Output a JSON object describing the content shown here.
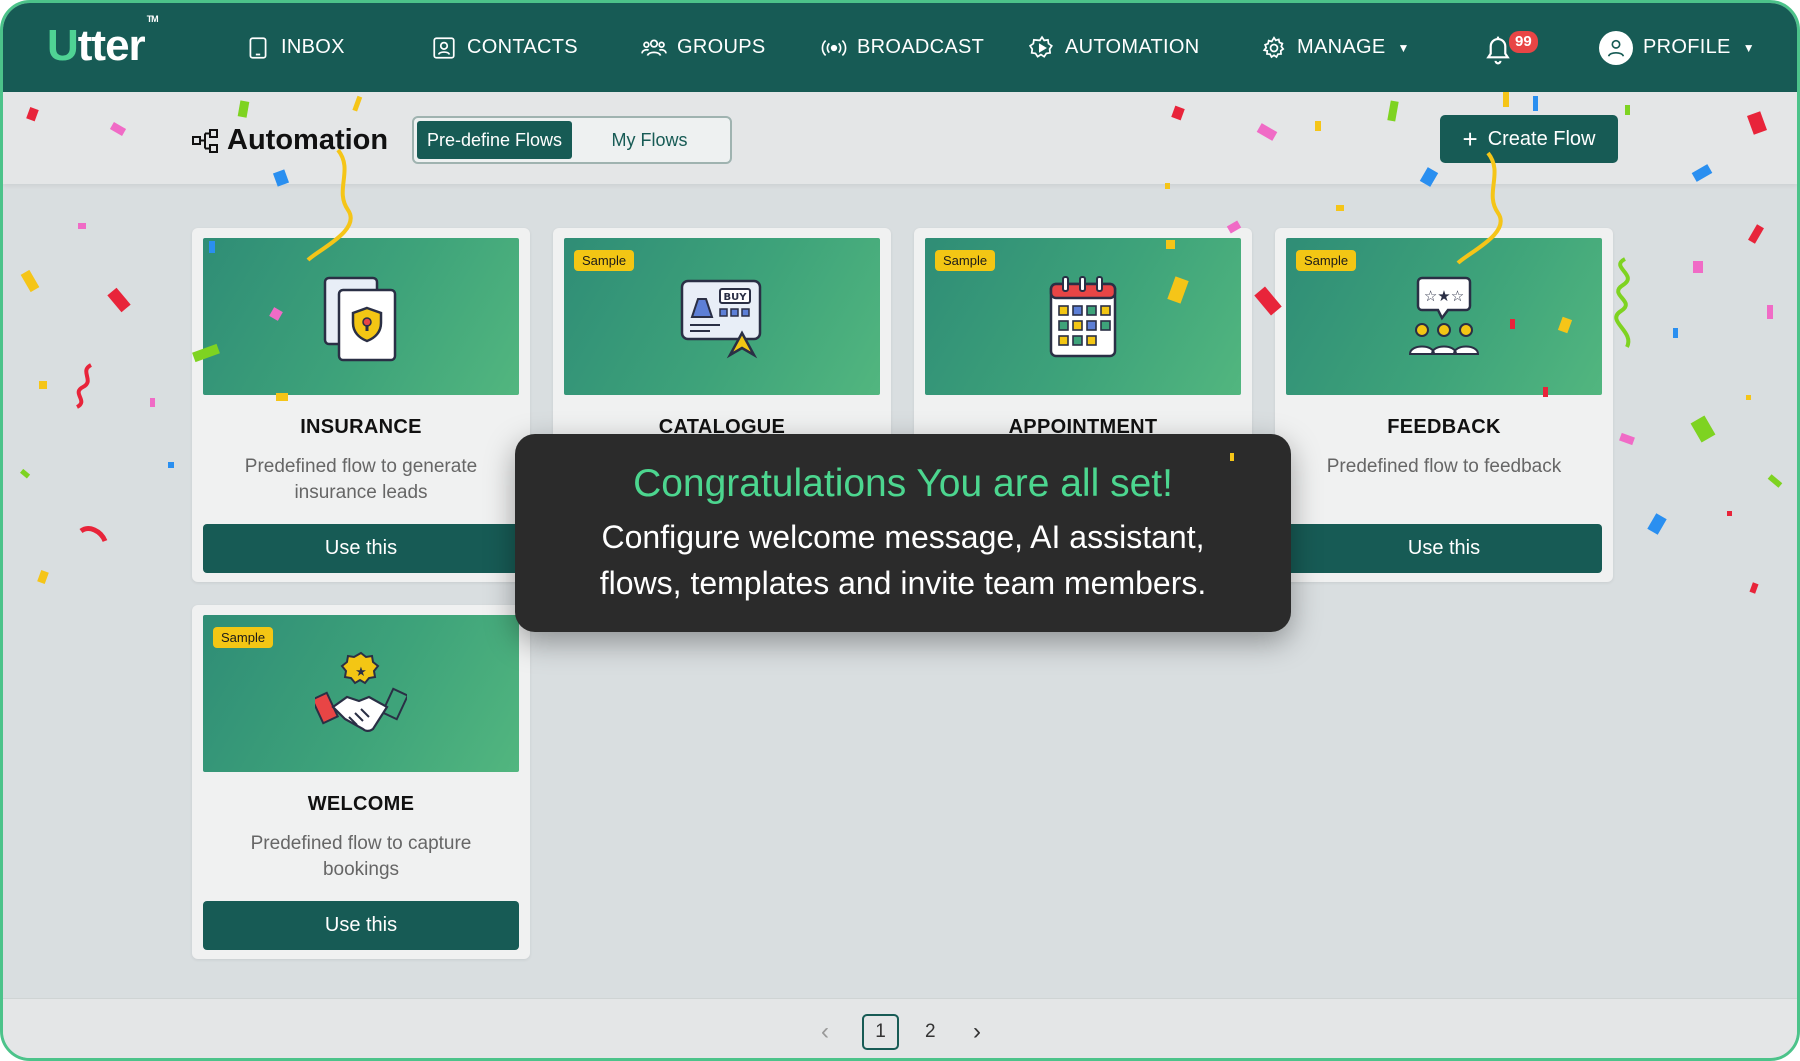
{
  "brand": {
    "logo_accent": "U",
    "logo_rest": "tter",
    "trademark": "TM",
    "primary_color": "#175b55",
    "accent_color": "#4fd394"
  },
  "nav": {
    "items": [
      {
        "id": "inbox",
        "label": "INBOX",
        "icon": "tablet-icon"
      },
      {
        "id": "contacts",
        "label": "CONTACTS",
        "icon": "contact-card-icon"
      },
      {
        "id": "groups",
        "label": "GROUPS",
        "icon": "users-icon"
      },
      {
        "id": "broadcast",
        "label": "BROADCAST",
        "icon": "broadcast-icon"
      },
      {
        "id": "automation",
        "label": "AUTOMATION",
        "icon": "gear-play-icon"
      },
      {
        "id": "manage",
        "label": "MANAGE",
        "icon": "gear-icon"
      }
    ],
    "notifications": "99",
    "profile_label": "PROFILE"
  },
  "toolbar": {
    "title": "Automation",
    "tabs": [
      "Pre-define Flows",
      "My Flows"
    ],
    "active_tab": "Pre-define Flows",
    "create_label": "+ Create Flow",
    "create_text": "Create Flow"
  },
  "cards": [
    {
      "title": "INSURANCE",
      "desc": "Predefined flow to generate insurance leads",
      "badge": "",
      "button": "Use this",
      "icon": "insurance-shield-icon"
    },
    {
      "title": "CATALOGUE",
      "desc": "",
      "badge": "Sample",
      "button": "",
      "icon": "catalogue-buy-icon"
    },
    {
      "title": "APPOINTMENT",
      "desc": "",
      "badge": "Sample",
      "button": "",
      "icon": "calendar-icon"
    },
    {
      "title": "FEEDBACK",
      "desc": "Predefined flow to feedback",
      "badge": "Sample",
      "button": "Use this",
      "icon": "feedback-stars-icon"
    },
    {
      "title": "WELCOME",
      "desc": "Predefined flow to capture bookings",
      "badge": "Sample",
      "button": "Use this",
      "icon": "handshake-icon"
    }
  ],
  "toast": {
    "title": "Congratulations You are all set!",
    "body": "Configure welcome message, AI assistant, flows, templates and invite team members."
  },
  "pagination": {
    "prev": "‹",
    "pages": [
      "1",
      "2"
    ],
    "current": "1",
    "next": "›"
  }
}
